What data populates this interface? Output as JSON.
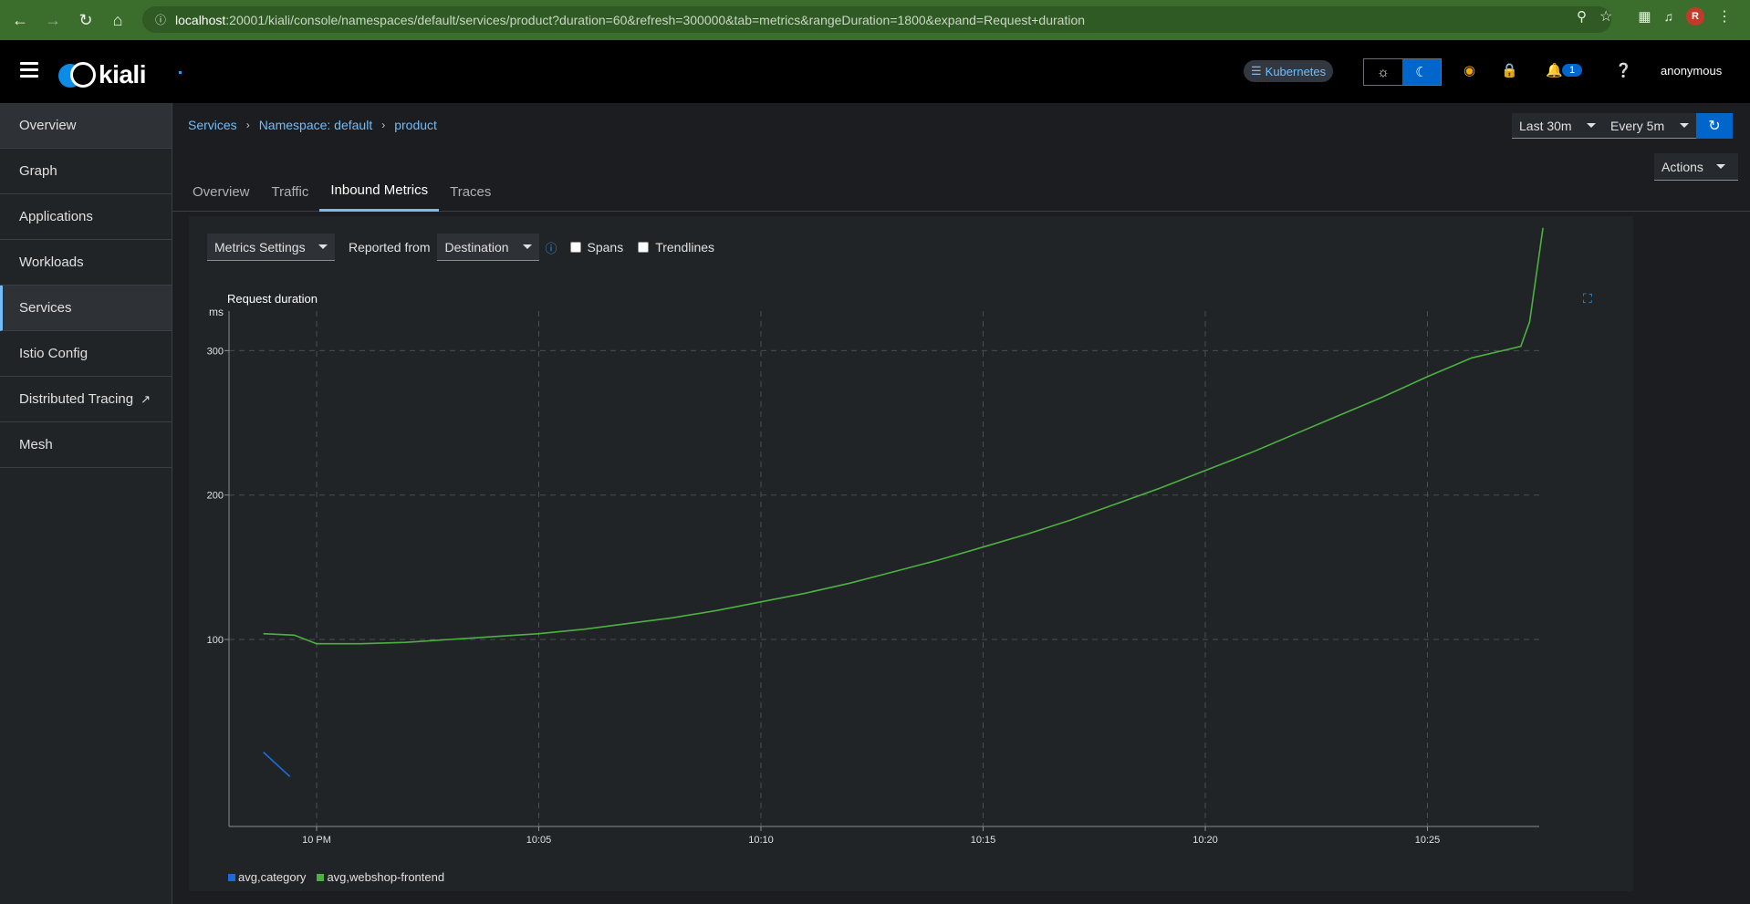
{
  "browser": {
    "url_host": "localhost",
    "url_rest": ":20001/kiali/console/namespaces/default/services/product?duration=60&refresh=300000&tab=metrics&rangeDuration=1800&expand=Request+duration",
    "profile_initial": "R"
  },
  "masthead": {
    "logo_text": "kiali",
    "cluster_badge": "Kubernetes",
    "notification_count": "1",
    "user": "anonymous"
  },
  "sidebar": {
    "items": [
      {
        "label": "Overview"
      },
      {
        "label": "Graph"
      },
      {
        "label": "Applications"
      },
      {
        "label": "Workloads"
      },
      {
        "label": "Services"
      },
      {
        "label": "Istio Config"
      },
      {
        "label": "Distributed Tracing"
      },
      {
        "label": "Mesh"
      }
    ]
  },
  "breadcrumb": {
    "services": "Services",
    "namespace": "Namespace: default",
    "service": "product"
  },
  "range": {
    "duration": "Last 30m",
    "refresh": "Every 5m"
  },
  "actions_label": "Actions",
  "tabs": [
    {
      "label": "Overview"
    },
    {
      "label": "Traffic"
    },
    {
      "label": "Inbound Metrics"
    },
    {
      "label": "Traces"
    }
  ],
  "toolbar": {
    "metrics_settings": "Metrics Settings",
    "reported_from_label": "Reported from",
    "reported_from_value": "Destination",
    "spans_label": "Spans",
    "trendlines_label": "Trendlines"
  },
  "colors": {
    "accent": "#0066cc",
    "link": "#73bcf7",
    "series_category": "#1a6cd4",
    "series_frontend": "#4cb140"
  },
  "chart_data": {
    "type": "line",
    "title": "Request duration",
    "ylabel": "ms",
    "xlabel": "",
    "x_ticks": [
      "10 PM",
      "10:05",
      "10:10",
      "10:15",
      "10:20",
      "10:25"
    ],
    "y_ticks": [
      100,
      200,
      300
    ],
    "grid": true,
    "legend_position": "bottom-left",
    "series": [
      {
        "name": "avg,category",
        "color": "#1a6cd4",
        "points": [
          [
            -1.2,
            22
          ],
          [
            -0.6,
            5
          ]
        ]
      },
      {
        "name": "avg,webshop-frontend",
        "color": "#4cb140",
        "points": [
          [
            -1.2,
            104
          ],
          [
            -0.5,
            103
          ],
          [
            0,
            97
          ],
          [
            1,
            97
          ],
          [
            2,
            98
          ],
          [
            3,
            100
          ],
          [
            4,
            102
          ],
          [
            5,
            104
          ],
          [
            6,
            107
          ],
          [
            7,
            111
          ],
          [
            8,
            115
          ],
          [
            9,
            120
          ],
          [
            10,
            126
          ],
          [
            11,
            132
          ],
          [
            12,
            139
          ],
          [
            13,
            147
          ],
          [
            14,
            155
          ],
          [
            15,
            164
          ],
          [
            16,
            173
          ],
          [
            17,
            183
          ],
          [
            18,
            194
          ],
          [
            19,
            205
          ],
          [
            20,
            217
          ],
          [
            21,
            229
          ],
          [
            22,
            242
          ],
          [
            23,
            255
          ],
          [
            24,
            268
          ],
          [
            25,
            282
          ],
          [
            26,
            295
          ],
          [
            27.1,
            303
          ],
          [
            27.3,
            320
          ],
          [
            27.6,
            385
          ]
        ]
      }
    ],
    "x_range_minutes": [
      -2.6,
      27.9
    ],
    "y_range": [
      10,
      385
    ]
  }
}
